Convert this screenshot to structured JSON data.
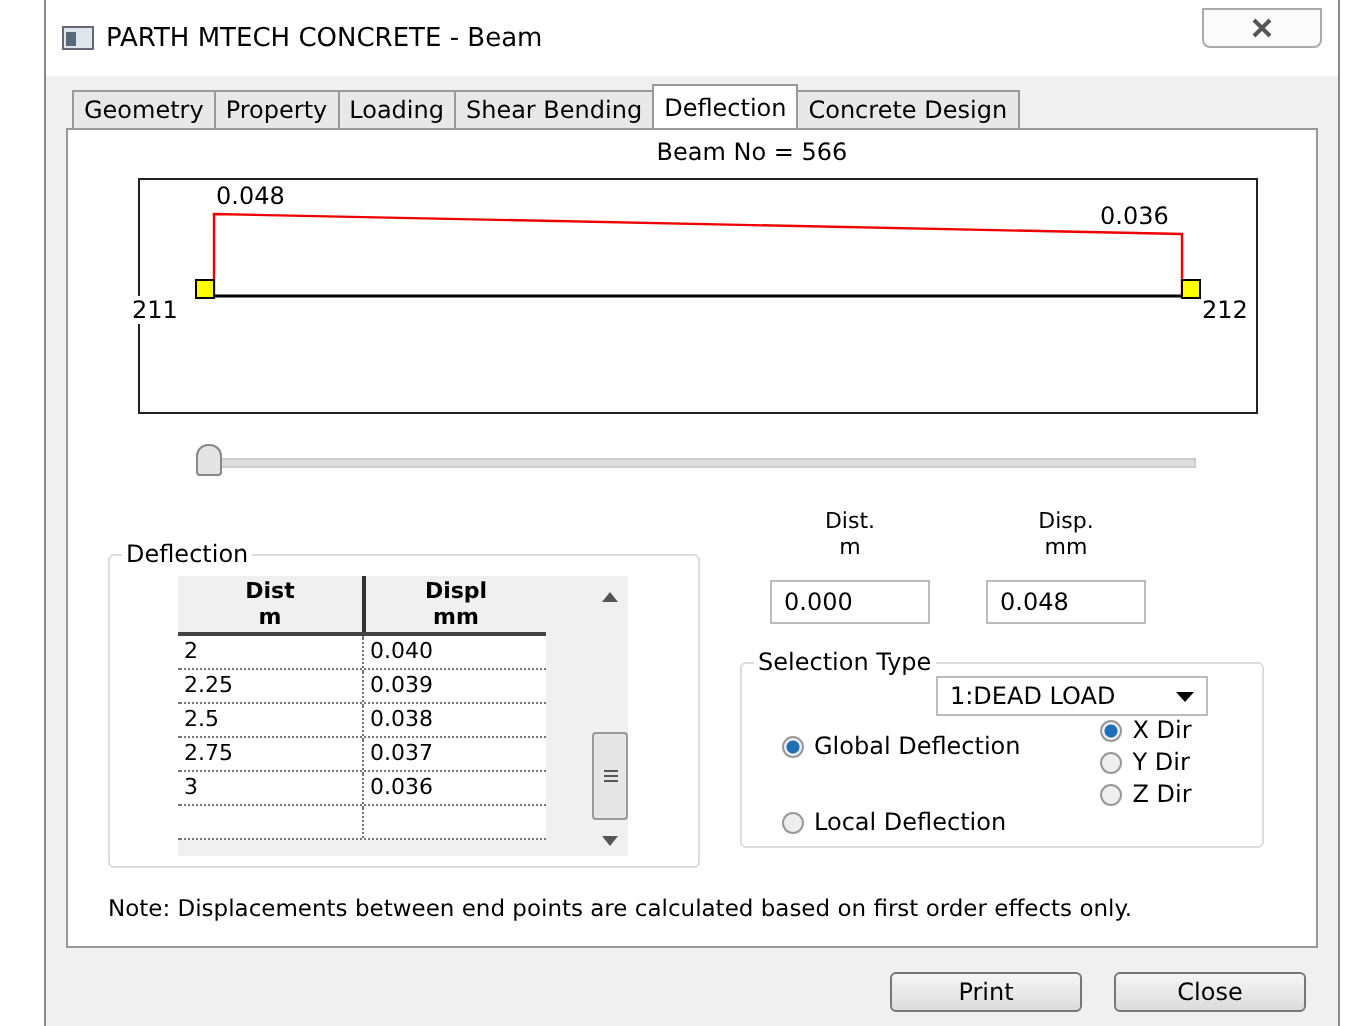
{
  "window": {
    "title": "PARTH MTECH CONCRETE - Beam"
  },
  "tabs": [
    {
      "label": "Geometry",
      "selected": false
    },
    {
      "label": "Property",
      "selected": false
    },
    {
      "label": "Loading",
      "selected": false
    },
    {
      "label": "Shear Bending",
      "selected": false
    },
    {
      "label": "Deflection",
      "selected": true
    },
    {
      "label": "Concrete Design",
      "selected": false
    }
  ],
  "beam_label": "Beam No = 566",
  "diagram": {
    "start_value": "0.048",
    "end_value": "0.036",
    "start_node": "211",
    "end_node": "212"
  },
  "position_slider": {
    "level": 0
  },
  "deflection_group": {
    "title": "Deflection",
    "columns": [
      {
        "line1": "Dist",
        "line2": "m"
      },
      {
        "line1": "Displ",
        "line2": "mm"
      }
    ],
    "rows": [
      [
        "2",
        "0.040"
      ],
      [
        "2.25",
        "0.039"
      ],
      [
        "2.5",
        "0.038"
      ],
      [
        "2.75",
        "0.037"
      ],
      [
        "3",
        "0.036"
      ]
    ]
  },
  "readout": {
    "dist_label": [
      "Dist.",
      "m"
    ],
    "disp_label": [
      "Disp.",
      "mm"
    ],
    "dist_value": "0.000",
    "disp_value": "0.048"
  },
  "selection_type": {
    "title": "Selection Type",
    "load_case": "1:DEAD LOAD",
    "modes": [
      {
        "label": "Global Deflection",
        "selected": true
      },
      {
        "label": "Local Deflection",
        "selected": false
      }
    ],
    "directions": [
      {
        "label": "X Dir",
        "selected": true
      },
      {
        "label": "Y Dir",
        "selected": false
      },
      {
        "label": "Z Dir",
        "selected": false
      }
    ]
  },
  "note": "Note: Displacements between end points are calculated based on first order effects only.",
  "buttons": [
    "Print",
    "Close"
  ]
}
